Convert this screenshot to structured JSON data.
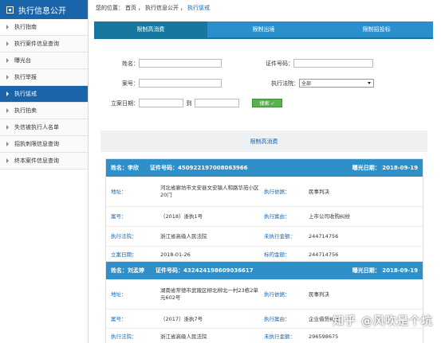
{
  "sidebar": {
    "title": "执行信息公开",
    "items": [
      {
        "label": "执行指南",
        "active": false
      },
      {
        "label": "执行案件信息查询",
        "active": false
      },
      {
        "label": "曝光台",
        "active": false
      },
      {
        "label": "执行举报",
        "active": false
      },
      {
        "label": "执行惩戒",
        "active": true
      },
      {
        "label": "执行拍卖",
        "active": false
      },
      {
        "label": "失信被执行人名单",
        "active": false
      },
      {
        "label": "招执刺限信息查询",
        "active": false
      },
      {
        "label": "终本案件信息查询",
        "active": false
      }
    ]
  },
  "breadcrumb": {
    "prefix": "您的位置：",
    "home": "首页",
    "sep1": "，",
    "section": "执行信息公开",
    "sep2": "，",
    "current": "执行惩戒"
  },
  "tabs": [
    {
      "label": "限制高消费"
    },
    {
      "label": "限制出境"
    },
    {
      "label": "限制招投标"
    }
  ],
  "form": {
    "name_label": "姓名：",
    "id_label": "证件号码：",
    "case_label": "案号：",
    "court_label": "执行法院：",
    "court_value": "全部",
    "date_label": "立案日期：",
    "to_label": "到",
    "search_label": "搜索 ✓"
  },
  "list_title": "限制高消费",
  "records": [
    {
      "name_label": "姓名：",
      "name": "李欣",
      "id_label": "证件号码：",
      "id": "450922197008063966",
      "date_label": "曝光日期：",
      "date": "2018-09-19",
      "address_label": "地址：",
      "address": "河北省廊坊市文安县文安镇人和路华苑小区20门",
      "basis_label": "执行依据：",
      "basis": "民事判决",
      "case_label": "案号：",
      "case": "（2018）浙执1号",
      "reason_label": "执行案由：",
      "reason": "上市公司收购纠纷",
      "court_label": "执行法院：",
      "court": "浙江省高级人民法院",
      "unpaid_label": "未执行金额：",
      "unpaid": "244714756",
      "filed_label": "立案日期：",
      "filed": "2018-01-26",
      "target_label": "标的金额：",
      "target": "244714756"
    },
    {
      "name_label": "姓名：",
      "name": "刘孟婷",
      "id_label": "证件号码：",
      "id": "432424198609036617",
      "date_label": "曝光日期：",
      "date": "2018-09-19",
      "address_label": "地址：",
      "address": "湖南省常德市武陵区柳北柳北一村23栋2单元602号",
      "basis_label": "执行依据：",
      "basis": "民事判决",
      "case_label": "案号：",
      "case": "（2017）浙执7号",
      "reason_label": "执行案由：",
      "reason": "企业借贷纠纷",
      "court_label": "执行法院：",
      "court": "浙江省高级人民法院",
      "unpaid_label": "未执行金额：",
      "unpaid": "296598675"
    }
  ],
  "watermark": "知乎 @风吹是个坑"
}
